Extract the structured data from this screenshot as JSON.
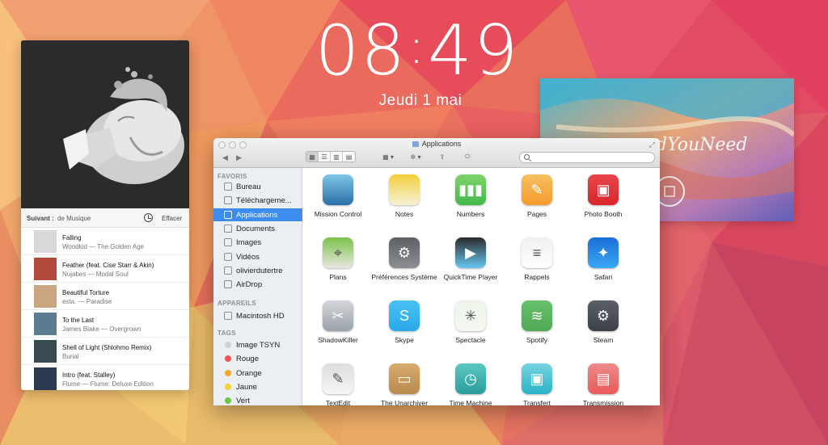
{
  "lockscreen": {
    "hour": "08",
    "separator": ":",
    "minute": "49",
    "date": "Jeudi  1 mai"
  },
  "music": {
    "next_label": "Suivant :",
    "source": "de Musique",
    "clear_label": "Effacer",
    "tracks": [
      {
        "title": "Falling",
        "subtitle": "Woodkid — The Golden Age",
        "thumb_color": "#d9d9d9"
      },
      {
        "title": "Feather (feat. Cise Starr & Akin)",
        "subtitle": "Nujabes — Modal Soul",
        "thumb_color": "#b24a3c"
      },
      {
        "title": "Beautiful Torture",
        "subtitle": "esta. — Paradise",
        "thumb_color": "#c9a582"
      },
      {
        "title": "To the Last",
        "subtitle": "James Blake — Overgrown",
        "thumb_color": "#5b7b8f"
      },
      {
        "title": "Shell of Light (Shlohmo Remix)",
        "subtitle": "Burial",
        "thumb_color": "#3a4a52"
      },
      {
        "title": "Intro (feat. Stalley)",
        "subtitle": "Flume — Flume: Deluxe Edition",
        "thumb_color": "#2b3a4e"
      }
    ]
  },
  "photo_widget": {
    "caption": "dYouNeed"
  },
  "finder": {
    "title": "Applications",
    "sidebar": {
      "favorites_header": "FAVORIS",
      "devices_header": "APPAREILS",
      "tags_header": "TAGS",
      "favorites": [
        "Bureau",
        "Téléchargeme...",
        "Applications",
        "Documents",
        "Images",
        "Vidéos",
        "olivierdutertre",
        "AirDrop"
      ],
      "devices": [
        "Macintosh HD"
      ],
      "tags": [
        {
          "label": "Image TSYN",
          "color": "#d0d0d0"
        },
        {
          "label": "Rouge",
          "color": "#f0564f"
        },
        {
          "label": "Orange",
          "color": "#f5a623"
        },
        {
          "label": "Jaune",
          "color": "#f3d42e"
        },
        {
          "label": "Vert",
          "color": "#6cc644"
        }
      ]
    },
    "apps": [
      {
        "label": "Mission Control",
        "bg": "#2a6fa8",
        "bg2": "#7fc6e8",
        "glyph": ""
      },
      {
        "label": "Notes",
        "bg": "#f6f1d5",
        "bg2": "#f3cf3b",
        "glyph": ""
      },
      {
        "label": "Numbers",
        "bg": "#43b94a",
        "bg2": "#7fd36a",
        "glyph": "▮▮▮"
      },
      {
        "label": "Pages",
        "bg": "#f49b2b",
        "bg2": "#f7c160",
        "glyph": "✎"
      },
      {
        "label": "Photo Booth",
        "bg": "#d8262b",
        "bg2": "#e9454a",
        "glyph": "▣"
      },
      {
        "label": "Plans",
        "bg": "#e9e7df",
        "bg2": "#7bc24a",
        "glyph": "⌖"
      },
      {
        "label": "Préférences Système",
        "bg": "#8a8d91",
        "bg2": "#5d6064",
        "glyph": "⚙"
      },
      {
        "label": "QuickTime Player",
        "bg": "#67c7f0",
        "bg2": "#2a2a2a",
        "glyph": "▶"
      },
      {
        "label": "Rappels",
        "bg": "#ffffff",
        "bg2": "#f0f0f0",
        "glyph": "≡"
      },
      {
        "label": "Safari",
        "bg": "#39a8f2",
        "bg2": "#1b6fd8",
        "glyph": "✦"
      },
      {
        "label": "ShadowKiller",
        "bg": "#9aa0a8",
        "bg2": "#d4d7db",
        "glyph": "✂"
      },
      {
        "label": "Skype",
        "bg": "#2aa9e8",
        "bg2": "#49c0f4",
        "glyph": "S"
      },
      {
        "label": "Spectacle",
        "bg": "#f4f8f1",
        "bg2": "#eef4ea",
        "glyph": "✳"
      },
      {
        "label": "Spotify",
        "bg": "#4fa955",
        "bg2": "#66c06c",
        "glyph": "≋"
      },
      {
        "label": "Steam",
        "bg": "#3c4047",
        "bg2": "#5b6069",
        "glyph": "⚙"
      },
      {
        "label": "TextEdit",
        "bg": "#f5f5f5",
        "bg2": "#dedede",
        "glyph": "✎"
      },
      {
        "label": "The Unarchiver",
        "bg": "#b98a4e",
        "bg2": "#d7ab6b",
        "glyph": "▭"
      },
      {
        "label": "Time Machine",
        "bg": "#2a9d9a",
        "bg2": "#5cc7c2",
        "glyph": "◷"
      },
      {
        "label": "Transfert",
        "bg": "#2ab3c7",
        "bg2": "#76d3df",
        "glyph": "▣"
      },
      {
        "label": "Transmission",
        "bg": "#e85a5a",
        "bg2": "#f08a8a",
        "glyph": "▤"
      }
    ]
  }
}
